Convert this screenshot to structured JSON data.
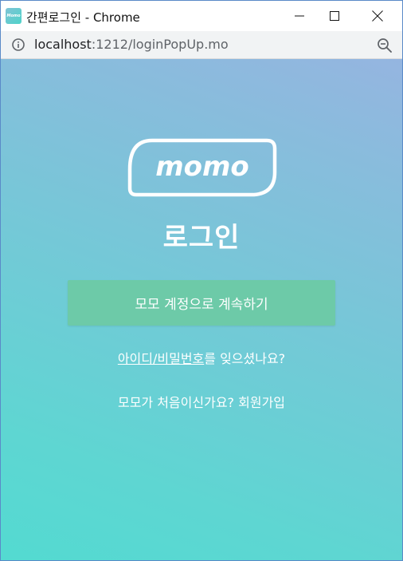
{
  "window": {
    "app_icon_text": "Momo",
    "title": "간편로그인 - Chrome"
  },
  "address_bar": {
    "url_host": "localhost",
    "url_path": ":1212/loginPopUp.mo"
  },
  "page": {
    "logo_text": "momo",
    "heading": "로그인",
    "continue_button": "모모 계정으로 계속하기",
    "forgot_link": "아이디/비밀번호",
    "forgot_suffix": "를 잊으셨나요?",
    "signup_prompt": "모모가 처음이신가요?",
    "signup_link": "회원가입"
  },
  "colors": {
    "gradient_top": "#95b5e0",
    "gradient_bottom": "#53dad1",
    "button_green": "#6dcaa8",
    "text_white": "#ffffff"
  },
  "icons": [
    "info-icon",
    "zoom-out-icon",
    "minimize-icon",
    "maximize-icon",
    "close-icon"
  ]
}
